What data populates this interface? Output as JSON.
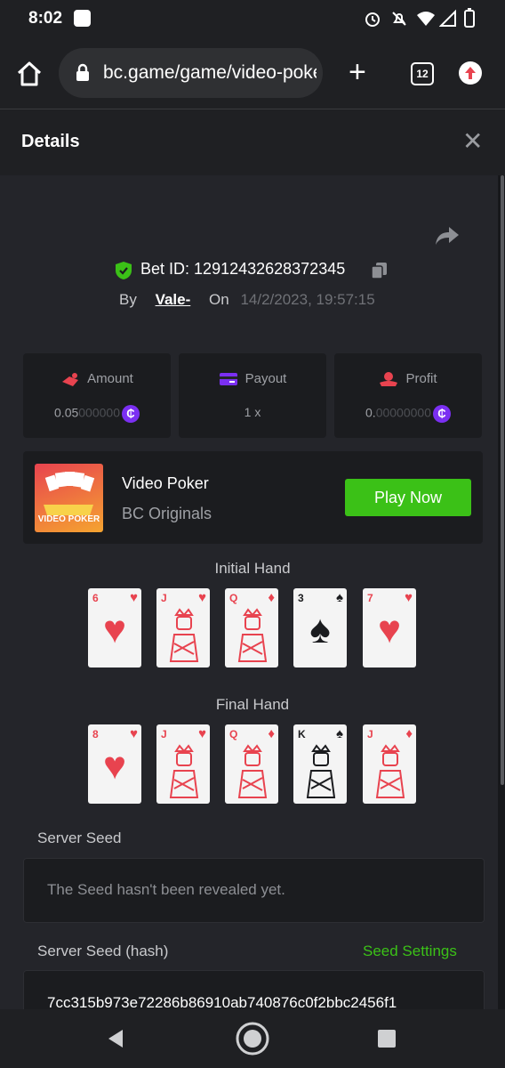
{
  "status_bar": {
    "time": "8:02"
  },
  "browser": {
    "url": "bc.game/game/video-poker",
    "tab_count": "12"
  },
  "details": {
    "title": "Details",
    "bet_id_label": "Bet ID:",
    "bet_id": "12912432628372345",
    "by_label": "By",
    "user": "Vale-",
    "on_label": "On",
    "date": "14/2/2023, 19:57:15"
  },
  "stats": {
    "amount_label": "Amount",
    "amount_main": "0.05",
    "amount_dim": "000000",
    "payout_label": "Payout",
    "payout_value": "1 x",
    "profit_label": "Profit",
    "profit_main": "0.",
    "profit_dim": "00000000",
    "coin_symbol": "₵"
  },
  "game": {
    "thumb_label": "VIDEO POKER",
    "name": "Video Poker",
    "provider": "BC Originals",
    "play_label": "Play Now"
  },
  "initial_hand": {
    "label": "Initial Hand",
    "cards": [
      {
        "rank": "6",
        "suit": "♥",
        "color": "red"
      },
      {
        "rank": "J",
        "suit": "♥",
        "color": "red"
      },
      {
        "rank": "Q",
        "suit": "♦",
        "color": "red"
      },
      {
        "rank": "3",
        "suit": "♠",
        "color": "black"
      },
      {
        "rank": "7",
        "suit": "♥",
        "color": "red"
      }
    ]
  },
  "final_hand": {
    "label": "Final Hand",
    "cards": [
      {
        "rank": "8",
        "suit": "♥",
        "color": "red"
      },
      {
        "rank": "J",
        "suit": "♥",
        "color": "red"
      },
      {
        "rank": "Q",
        "suit": "♦",
        "color": "red"
      },
      {
        "rank": "K",
        "suit": "♠",
        "color": "black"
      },
      {
        "rank": "J",
        "suit": "♦",
        "color": "red"
      }
    ]
  },
  "seed": {
    "server_seed_label": "Server Seed",
    "server_seed_message": "The Seed hasn't been revealed yet.",
    "hash_label": "Server Seed (hash)",
    "seed_settings_label": "Seed Settings",
    "hash_value": "7cc315b973e72286b86910ab740876c0f2bbc2456f1"
  },
  "colors": {
    "accent_green": "#3bc117",
    "coin_purple": "#7b2ff2",
    "suit_red": "#e8434f"
  }
}
